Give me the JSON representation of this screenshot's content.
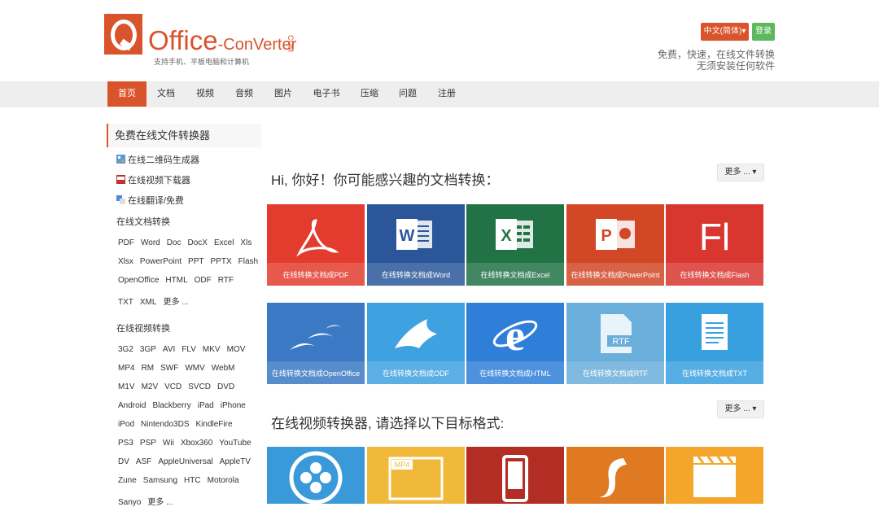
{
  "logo": {
    "main": "Office",
    "dash": "-",
    "sub": "ConVerter",
    "vertical": "COM",
    "tagline": "支持手机、平板电脑和计算机"
  },
  "header": {
    "lang": "中文(简体)▾",
    "login": "登录",
    "tagline1": "免费，快速，在线文件转换",
    "tagline2": "无须安装任何软件"
  },
  "nav": [
    "首页",
    "文档",
    "视频",
    "音频",
    "图片",
    "电子书",
    "压缩",
    "问题",
    "注册"
  ],
  "sidebar": {
    "heading": "免费在线文件转换器",
    "links": [
      "在线二维码生成器",
      "在线视频下载器",
      "在线翻译/免费"
    ],
    "doc_section": "在线文档转换",
    "doc_rows": [
      [
        "PDF",
        "Word",
        "Doc",
        "DocX",
        "Excel",
        "Xls"
      ],
      [
        "Xlsx",
        "PowerPoint",
        "PPT",
        "PPTX",
        "Flash"
      ],
      [
        "OpenOffice",
        "HTML",
        "ODF",
        "RTF"
      ],
      [
        "TXT",
        "XML",
        "更多 ..."
      ]
    ],
    "video_section": "在线视频转换",
    "video_rows": [
      [
        "3G2",
        "3GP",
        "AVI",
        "FLV",
        "MKV",
        "MOV"
      ],
      [
        "MP4",
        "RM",
        "SWF",
        "WMV",
        "WebM"
      ],
      [
        "M1V",
        "M2V",
        "VCD",
        "SVCD",
        "DVD"
      ],
      [
        "Android",
        "Blackberry",
        "iPad",
        "iPhone"
      ],
      [
        "iPod",
        "Nintendo3DS",
        "KindleFire"
      ],
      [
        "PS3",
        "PSP",
        "Wii",
        "Xbox360",
        "YouTube"
      ],
      [
        "DV",
        "ASF",
        "AppleUniversal",
        "AppleTV"
      ],
      [
        "Zune",
        "Samsung",
        "HTC",
        "Motorola"
      ],
      [
        "Sanyo",
        "更多 ..."
      ]
    ]
  },
  "main": {
    "doc_title": "Hi, 你好！你可能感兴趣的文档转换：",
    "more": "更多 ... ▾",
    "video_title": "在线视频转换器, 请选择以下目标格式:",
    "doc_tiles": [
      {
        "label": "在线转换文档成PDF",
        "color": "#e33b2e",
        "icon": "pdf-icon"
      },
      {
        "label": "在线转换文档成Word",
        "color": "#2b579a",
        "icon": "word-icon"
      },
      {
        "label": "在线转换文档成Excel",
        "color": "#217346",
        "icon": "excel-icon"
      },
      {
        "label": "在线转换文档成PowerPoint",
        "color": "#d24726",
        "icon": "powerpoint-icon"
      },
      {
        "label": "在线转换文档成Flash",
        "color": "#d93630",
        "icon": "flash-icon"
      },
      {
        "label": "在线转换文档成OpenOffice",
        "color": "#3b79c4",
        "icon": "openoffice-icon"
      },
      {
        "label": "在线转换文档成ODF",
        "color": "#3fa2e0",
        "icon": "odf-icon"
      },
      {
        "label": "在线转换文档成HTML",
        "color": "#2f7ed8",
        "icon": "html-icon"
      },
      {
        "label": "在线转换文档成RTF",
        "color": "#6aaedb",
        "icon": "rtf-icon"
      },
      {
        "label": "在线转换文档成TXT",
        "color": "#39a0e0",
        "icon": "txt-icon"
      }
    ],
    "video_tiles": [
      {
        "color": "#3a9ad9",
        "icon": "film-reel-icon"
      },
      {
        "color": "#f0b93a",
        "icon": "mp4-icon"
      },
      {
        "color": "#b32d25",
        "icon": "mobile-icon"
      },
      {
        "color": "#e07a22",
        "icon": "flash-player-icon"
      },
      {
        "color": "#f4a62a",
        "icon": "clapperboard-icon"
      }
    ]
  }
}
